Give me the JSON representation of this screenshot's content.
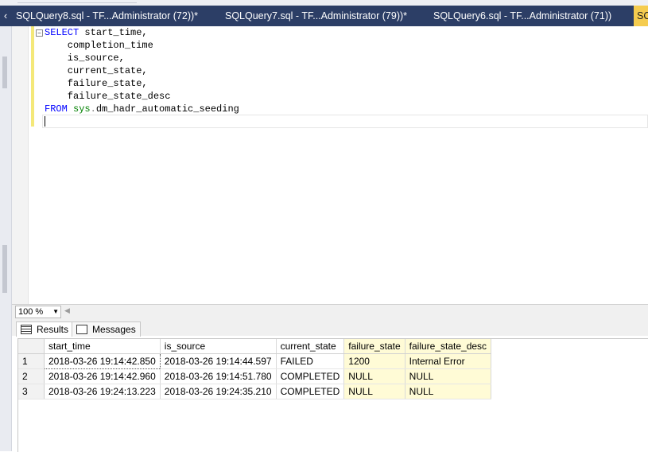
{
  "tabs": [
    {
      "label": "SQLQuery8.sql - TF...Administrator (72))*"
    },
    {
      "label": "SQLQuery7.sql - TF...Administrator (79))*"
    },
    {
      "label": "SQLQuery6.sql - TF...Administrator (71))"
    },
    {
      "label": "SC"
    }
  ],
  "editor": {
    "line1_kw": "SELECT",
    "line1_rest": " start_time,",
    "line2": "    completion_time",
    "line3": "    is_source,",
    "line4": "    current_state,",
    "line5": "    failure_state,",
    "line6": "    failure_state_desc",
    "line7_kw": "FROM",
    "line7_schema": "sys",
    "line7_obj": "dm_hadr_automatic_seeding"
  },
  "zoom": {
    "value": "100 %"
  },
  "result_tabs": {
    "results": "Results",
    "messages": "Messages"
  },
  "grid": {
    "columns": [
      "start_time",
      "is_source",
      "current_state",
      "failure_state",
      "failure_state_desc"
    ],
    "rows": [
      {
        "num": "1",
        "start_time": "2018-03-26 19:14:42.850",
        "is_source": "2018-03-26 19:14:44.597",
        "current_state": "FAILED",
        "failure_state": "1200",
        "failure_state_desc": "Internal Error"
      },
      {
        "num": "2",
        "start_time": "2018-03-26 19:14:42.960",
        "is_source": "2018-03-26 19:14:51.780",
        "current_state": "COMPLETED",
        "failure_state": "NULL",
        "failure_state_desc": "NULL"
      },
      {
        "num": "3",
        "start_time": "2018-03-26 19:24:13.223",
        "is_source": "2018-03-26 19:24:35.210",
        "current_state": "COMPLETED",
        "failure_state": "NULL",
        "failure_state_desc": "NULL"
      }
    ]
  },
  "colors": {
    "tabbar": "#2c3e66",
    "active_tab": "#f5cc4f",
    "highlight": "#ffff00",
    "keyword": "#0000ff",
    "object": "#008000"
  }
}
